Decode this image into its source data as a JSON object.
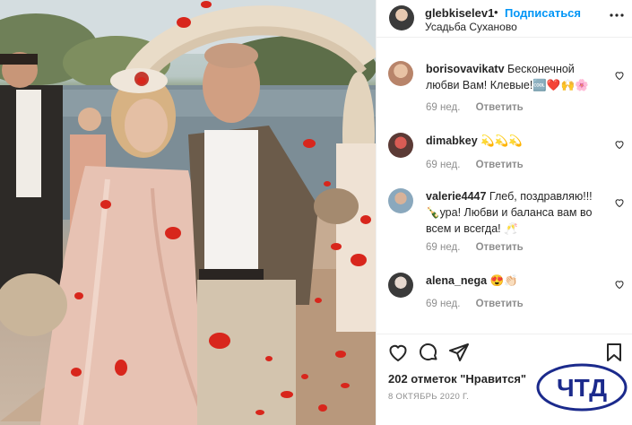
{
  "header": {
    "username": "glebkiselev1",
    "separator": "•",
    "follow_label": "Подписаться",
    "location": "Усадьба Суханово",
    "more_icon": "more-horizontal-icon"
  },
  "comments": [
    {
      "username": "borisovavikatv",
      "text": "Бесконечной любви Вам! Клевые!🆒❤️🙌🌸",
      "age": "69 нед.",
      "reply_label": "Ответить",
      "avatar_color": "#d9a88a"
    },
    {
      "username": "dimabkey",
      "text": "💫💫💫",
      "age": "69 нед.",
      "reply_label": "Ответить",
      "avatar_color": "#7a4a40"
    },
    {
      "username": "valerie4447",
      "text": "Глеб, поздравляю!!! 🍾ура! Любви и баланса вам во всем и всегда! 🥂",
      "age": "69 нед.",
      "reply_label": "Ответить",
      "avatar_color": "#9fb7c9"
    },
    {
      "username": "alena_nega",
      "text": "😍👏🏻",
      "age": "69 нед.",
      "reply_label": "Ответить",
      "avatar_color": "#444444"
    }
  ],
  "actions": {
    "like_icon": "heart-icon",
    "comment_icon": "comment-icon",
    "share_icon": "share-icon",
    "save_icon": "bookmark-icon"
  },
  "likes_text": "202 отметок \"Нравится\"",
  "date_text": "8 ОКТЯБРЬ 2020 Г.",
  "watermark": {
    "text": "ЧТД",
    "color": "#1b2a8c"
  },
  "colors": {
    "accent": "#0095f6",
    "muted": "#8e8e8e",
    "text": "#262626",
    "petal": "#d8261c"
  }
}
